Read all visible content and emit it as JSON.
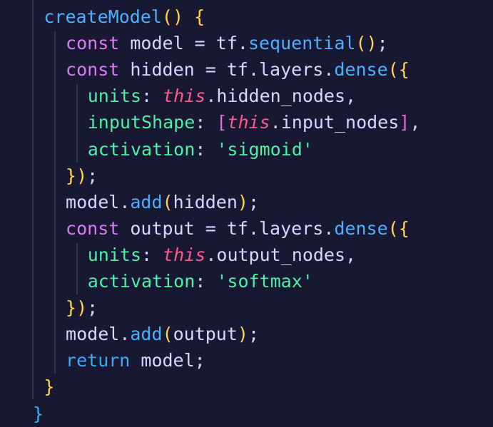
{
  "editor": {
    "background": "#191832",
    "lines": [
      {
        "indent": 2,
        "tokens": [
          {
            "t": "createModel",
            "c": "fn"
          },
          {
            "t": "() ",
            "c": "brace-yellow"
          },
          {
            "t": "{",
            "c": "brace-yellow"
          }
        ]
      },
      {
        "indent": 4,
        "tokens": [
          {
            "t": "const ",
            "c": "kw-const"
          },
          {
            "t": "model ",
            "c": "ident"
          },
          {
            "t": "= ",
            "c": "op"
          },
          {
            "t": "tf",
            "c": "ident"
          },
          {
            "t": ".",
            "c": "punc"
          },
          {
            "t": "sequential",
            "c": "fn"
          },
          {
            "t": "()",
            "c": "brace-yellow"
          },
          {
            "t": ";",
            "c": "punc"
          }
        ]
      },
      {
        "indent": 4,
        "tokens": [
          {
            "t": "const ",
            "c": "kw-const"
          },
          {
            "t": "hidden ",
            "c": "ident"
          },
          {
            "t": "= ",
            "c": "op"
          },
          {
            "t": "tf",
            "c": "ident"
          },
          {
            "t": ".",
            "c": "punc"
          },
          {
            "t": "layers",
            "c": "ident"
          },
          {
            "t": ".",
            "c": "punc"
          },
          {
            "t": "dense",
            "c": "fn"
          },
          {
            "t": "({",
            "c": "brace-yellow"
          }
        ]
      },
      {
        "indent": 6,
        "tokens": [
          {
            "t": "units",
            "c": "prop"
          },
          {
            "t": ": ",
            "c": "punc"
          },
          {
            "t": "this",
            "c": "this"
          },
          {
            "t": ".",
            "c": "punc"
          },
          {
            "t": "hidden_nodes",
            "c": "ident"
          },
          {
            "t": ",",
            "c": "punc"
          }
        ]
      },
      {
        "indent": 6,
        "tokens": [
          {
            "t": "inputShape",
            "c": "prop"
          },
          {
            "t": ": ",
            "c": "punc"
          },
          {
            "t": "[",
            "c": "brace-pink"
          },
          {
            "t": "this",
            "c": "this"
          },
          {
            "t": ".",
            "c": "punc"
          },
          {
            "t": "input_nodes",
            "c": "ident"
          },
          {
            "t": "]",
            "c": "brace-pink"
          },
          {
            "t": ",",
            "c": "punc"
          }
        ]
      },
      {
        "indent": 6,
        "tokens": [
          {
            "t": "activation",
            "c": "prop"
          },
          {
            "t": ": ",
            "c": "punc"
          },
          {
            "t": "'sigmoid'",
            "c": "str"
          }
        ]
      },
      {
        "indent": 4,
        "tokens": [
          {
            "t": "})",
            "c": "brace-yellow"
          },
          {
            "t": ";",
            "c": "punc"
          }
        ]
      },
      {
        "indent": 4,
        "tokens": [
          {
            "t": "model",
            "c": "ident"
          },
          {
            "t": ".",
            "c": "punc"
          },
          {
            "t": "add",
            "c": "fn"
          },
          {
            "t": "(",
            "c": "brace-yellow"
          },
          {
            "t": "hidden",
            "c": "ident"
          },
          {
            "t": ")",
            "c": "brace-yellow"
          },
          {
            "t": ";",
            "c": "punc"
          }
        ]
      },
      {
        "indent": 4,
        "tokens": [
          {
            "t": "const ",
            "c": "kw-const"
          },
          {
            "t": "output ",
            "c": "ident"
          },
          {
            "t": "= ",
            "c": "op"
          },
          {
            "t": "tf",
            "c": "ident"
          },
          {
            "t": ".",
            "c": "punc"
          },
          {
            "t": "layers",
            "c": "ident"
          },
          {
            "t": ".",
            "c": "punc"
          },
          {
            "t": "dense",
            "c": "fn"
          },
          {
            "t": "({",
            "c": "brace-yellow"
          }
        ]
      },
      {
        "indent": 6,
        "tokens": [
          {
            "t": "units",
            "c": "prop"
          },
          {
            "t": ": ",
            "c": "punc"
          },
          {
            "t": "this",
            "c": "this"
          },
          {
            "t": ".",
            "c": "punc"
          },
          {
            "t": "output_nodes",
            "c": "ident"
          },
          {
            "t": ",",
            "c": "punc"
          }
        ]
      },
      {
        "indent": 6,
        "tokens": [
          {
            "t": "activation",
            "c": "prop"
          },
          {
            "t": ": ",
            "c": "punc"
          },
          {
            "t": "'softmax'",
            "c": "str"
          }
        ]
      },
      {
        "indent": 4,
        "tokens": [
          {
            "t": "})",
            "c": "brace-yellow"
          },
          {
            "t": ";",
            "c": "punc"
          }
        ]
      },
      {
        "indent": 4,
        "tokens": [
          {
            "t": "model",
            "c": "ident"
          },
          {
            "t": ".",
            "c": "punc"
          },
          {
            "t": "add",
            "c": "fn"
          },
          {
            "t": "(",
            "c": "brace-yellow"
          },
          {
            "t": "output",
            "c": "ident"
          },
          {
            "t": ")",
            "c": "brace-yellow"
          },
          {
            "t": ";",
            "c": "punc"
          }
        ]
      },
      {
        "indent": 4,
        "tokens": [
          {
            "t": "return ",
            "c": "kw-ret"
          },
          {
            "t": "model",
            "c": "ident"
          },
          {
            "t": ";",
            "c": "punc"
          }
        ]
      },
      {
        "indent": 2,
        "tokens": [
          {
            "t": "}",
            "c": "brace-yellow"
          }
        ]
      },
      {
        "indent": 1,
        "tokens": [
          {
            "t": "}",
            "c": "brace-blue"
          }
        ]
      }
    ]
  }
}
